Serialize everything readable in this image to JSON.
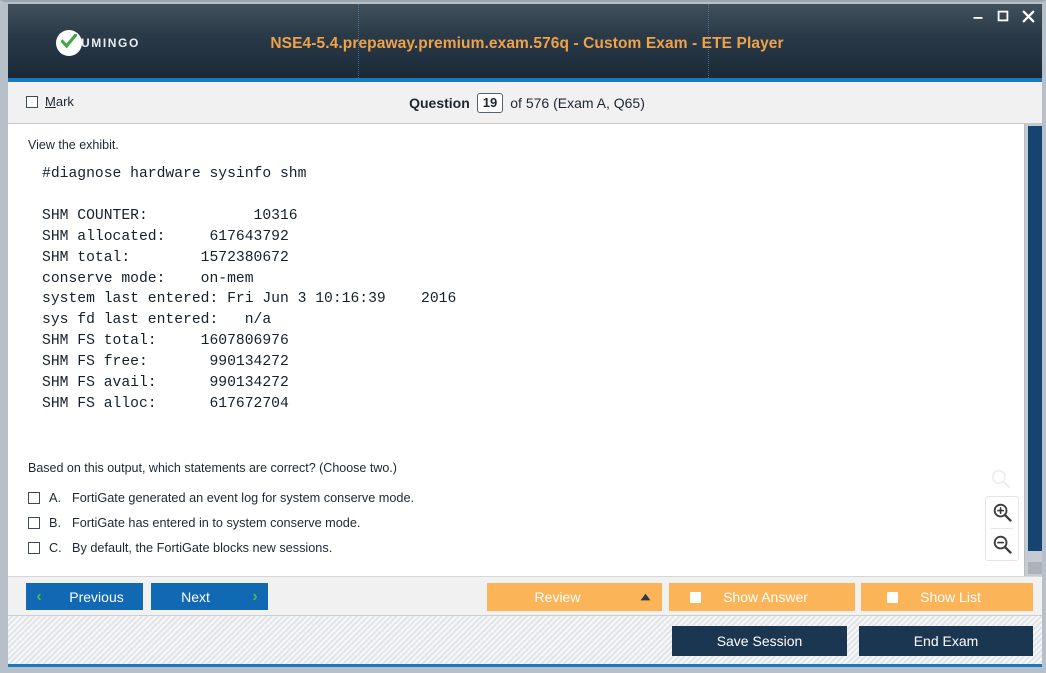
{
  "window": {
    "title": "NSE4-5.4.prepaway.premium.exam.576q - Custom Exam - ETE Player",
    "logo_text": "UMINGO",
    "minimize": "–",
    "maximize": "□",
    "close": "✕"
  },
  "question_bar": {
    "mark_label_pre": "",
    "mark_label_underline": "M",
    "mark_label_post": "ark",
    "question_label": "Question",
    "question_number": "19",
    "of_text": "of 576 (Exam A, Q65)"
  },
  "content": {
    "exhibit_link": "View the exhibit.",
    "console_output": "#diagnose hardware sysinfo shm\n\nSHM COUNTER:            10316\nSHM allocated:     617643792\nSHM total:        1572380672\nconserve mode:    on-mem\nsystem last entered: Fri Jun 3 10:16:39    2016\nsys fd last entered:   n/a\nSHM FS total:     1607806976\nSHM FS free:       990134272\nSHM FS avail:      990134272\nSHM FS alloc:      617672704",
    "question_text": "Based on this output, which statements are correct? (Choose two.)",
    "options": [
      {
        "letter": "A.",
        "text": "FortiGate generated an event log for system conserve mode."
      },
      {
        "letter": "B.",
        "text": "FortiGate has entered in to system conserve mode."
      },
      {
        "letter": "C.",
        "text": "By default, the FortiGate blocks new sessions."
      }
    ]
  },
  "navbar": {
    "previous": "Previous",
    "next": "Next",
    "review": "Review",
    "show_answer": "Show Answer",
    "show_list": "Show List",
    "prev_chevron": "‹",
    "next_chevron": "›"
  },
  "bottom": {
    "save_session": "Save Session",
    "end_exam": "End Exam"
  },
  "colors": {
    "accent_blue": "#1878c0",
    "button_blue": "#1169b3",
    "button_orange": "#fbb457",
    "button_navy": "#1b3650",
    "title_orange": "#f0a24a",
    "header_dark": "#2c3c49",
    "scrollbar_thumb": "#164470",
    "logo_green": "#3fa93f"
  }
}
